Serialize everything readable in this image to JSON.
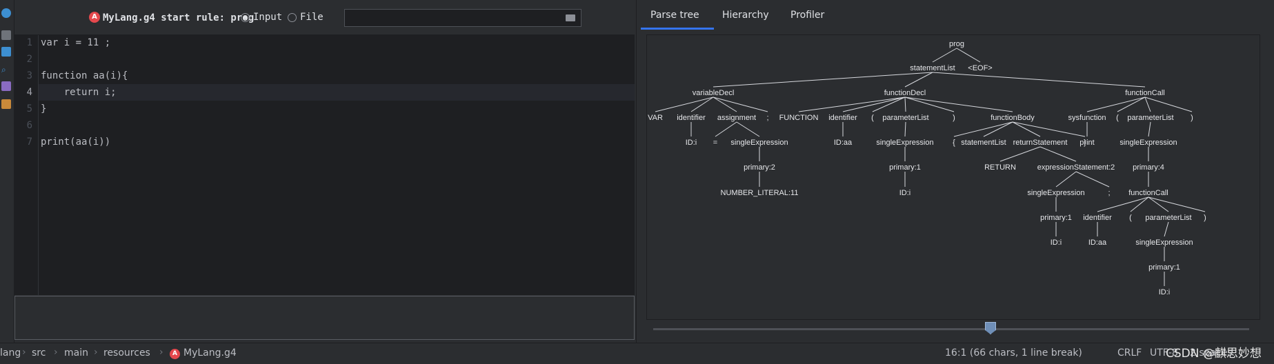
{
  "editor": {
    "rule_label": "MyLang.g4 start rule: prog",
    "input_label": "Input",
    "file_label": "File",
    "file_value": "",
    "lines": [
      {
        "n": "1",
        "text": "var i = 11 ;"
      },
      {
        "n": "2",
        "text": ""
      },
      {
        "n": "3",
        "text": "function aa(i){"
      },
      {
        "n": "4",
        "text": "    return i;"
      },
      {
        "n": "5",
        "text": "}"
      },
      {
        "n": "6",
        "text": ""
      },
      {
        "n": "7",
        "text": "print(aa(i))"
      }
    ]
  },
  "tabs": [
    "Parse tree",
    "Hierarchy",
    "Profiler"
  ],
  "tree": {
    "nodes": [
      {
        "id": "prog",
        "t": "prog"
      },
      {
        "id": "sl",
        "t": "statementList"
      },
      {
        "id": "eof",
        "t": "<EOF>"
      },
      {
        "id": "vd",
        "t": "variableDecl"
      },
      {
        "id": "fd",
        "t": "functionDecl"
      },
      {
        "id": "fc",
        "t": "functionCall"
      },
      {
        "id": "var",
        "t": "VAR"
      },
      {
        "id": "id1",
        "t": "identifier"
      },
      {
        "id": "asg",
        "t": "assignment"
      },
      {
        "id": "semi1",
        "t": ";"
      },
      {
        "id": "func",
        "t": "FUNCTION"
      },
      {
        "id": "id2",
        "t": "identifier"
      },
      {
        "id": "lp1",
        "t": "("
      },
      {
        "id": "pl1",
        "t": "parameterList"
      },
      {
        "id": "rp1",
        "t": ")"
      },
      {
        "id": "fb",
        "t": "functionBody"
      },
      {
        "id": "sysf",
        "t": "sysfunction"
      },
      {
        "id": "lp2",
        "t": "("
      },
      {
        "id": "pl2",
        "t": "parameterList"
      },
      {
        "id": "rp2",
        "t": ")"
      },
      {
        "id": "idi1",
        "t": "ID:i"
      },
      {
        "id": "eq",
        "t": "="
      },
      {
        "id": "se1",
        "t": "singleExpression"
      },
      {
        "id": "idaa1",
        "t": "ID:aa"
      },
      {
        "id": "se2",
        "t": "singleExpression"
      },
      {
        "id": "lb",
        "t": "{"
      },
      {
        "id": "sl2",
        "t": "statementList"
      },
      {
        "id": "rs",
        "t": "returnStatement"
      },
      {
        "id": "rb",
        "t": "}"
      },
      {
        "id": "print",
        "t": "print"
      },
      {
        "id": "se3",
        "t": "singleExpression"
      },
      {
        "id": "pr2",
        "t": "primary:2"
      },
      {
        "id": "pr1a",
        "t": "primary:1"
      },
      {
        "id": "ret",
        "t": "RETURN"
      },
      {
        "id": "es",
        "t": "expressionStatement:2"
      },
      {
        "id": "pr4",
        "t": "primary:4"
      },
      {
        "id": "num",
        "t": "NUMBER_LITERAL:11"
      },
      {
        "id": "idi2",
        "t": "ID:i"
      },
      {
        "id": "se4",
        "t": "singleExpression"
      },
      {
        "id": "semi2",
        "t": ";"
      },
      {
        "id": "fc2",
        "t": "functionCall"
      },
      {
        "id": "pr1b",
        "t": "primary:1"
      },
      {
        "id": "id3",
        "t": "identifier"
      },
      {
        "id": "lp3",
        "t": "("
      },
      {
        "id": "pl3",
        "t": "parameterList"
      },
      {
        "id": "rp3",
        "t": ")"
      },
      {
        "id": "idi3",
        "t": "ID:i"
      },
      {
        "id": "idaa2",
        "t": "ID:aa"
      },
      {
        "id": "se5",
        "t": "singleExpression"
      },
      {
        "id": "pr1c",
        "t": "primary:1"
      },
      {
        "id": "idi4",
        "t": "ID:i"
      }
    ],
    "edges": [
      [
        "prog",
        "sl"
      ],
      [
        "prog",
        "eof"
      ],
      [
        "sl",
        "vd"
      ],
      [
        "sl",
        "fd"
      ],
      [
        "sl",
        "fc"
      ],
      [
        "vd",
        "var"
      ],
      [
        "vd",
        "id1"
      ],
      [
        "vd",
        "asg"
      ],
      [
        "vd",
        "semi1"
      ],
      [
        "fd",
        "func"
      ],
      [
        "fd",
        "id2"
      ],
      [
        "fd",
        "lp1"
      ],
      [
        "fd",
        "pl1"
      ],
      [
        "fd",
        "rp1"
      ],
      [
        "fd",
        "fb"
      ],
      [
        "fc",
        "sysf"
      ],
      [
        "fc",
        "lp2"
      ],
      [
        "fc",
        "pl2"
      ],
      [
        "fc",
        "rp2"
      ],
      [
        "id1",
        "idi1"
      ],
      [
        "asg",
        "eq"
      ],
      [
        "asg",
        "se1"
      ],
      [
        "id2",
        "idaa1"
      ],
      [
        "pl1",
        "se2"
      ],
      [
        "fb",
        "lb"
      ],
      [
        "fb",
        "sl2"
      ],
      [
        "fb",
        "rs"
      ],
      [
        "fb",
        "rb"
      ],
      [
        "sysf",
        "print"
      ],
      [
        "pl2",
        "se3"
      ],
      [
        "se1",
        "pr2"
      ],
      [
        "se2",
        "pr1a"
      ],
      [
        "rs",
        "ret"
      ],
      [
        "rs",
        "es"
      ],
      [
        "se3",
        "pr4"
      ],
      [
        "pr2",
        "num"
      ],
      [
        "pr1a",
        "idi2"
      ],
      [
        "es",
        "se4"
      ],
      [
        "es",
        "semi2"
      ],
      [
        "pr4",
        "fc2"
      ],
      [
        "se4",
        "pr1b"
      ],
      [
        "fc2",
        "id3"
      ],
      [
        "fc2",
        "lp3"
      ],
      [
        "fc2",
        "pl3"
      ],
      [
        "fc2",
        "rp3"
      ],
      [
        "pr1b",
        "idi3"
      ],
      [
        "id3",
        "idaa2"
      ],
      [
        "pl3",
        "se5"
      ],
      [
        "se5",
        "pr1c"
      ],
      [
        "pr1c",
        "idi4"
      ]
    ]
  },
  "statusbar": {
    "breadcrumbs": [
      "lang",
      "src",
      "main",
      "resources",
      "MyLang.g4"
    ],
    "position": "16:1 (66 chars, 1 line break)",
    "line_ending": "CRLF",
    "encoding": "UTF-8",
    "indent": "2 spaces",
    "watermark": "CSDN @麒思妙想"
  }
}
